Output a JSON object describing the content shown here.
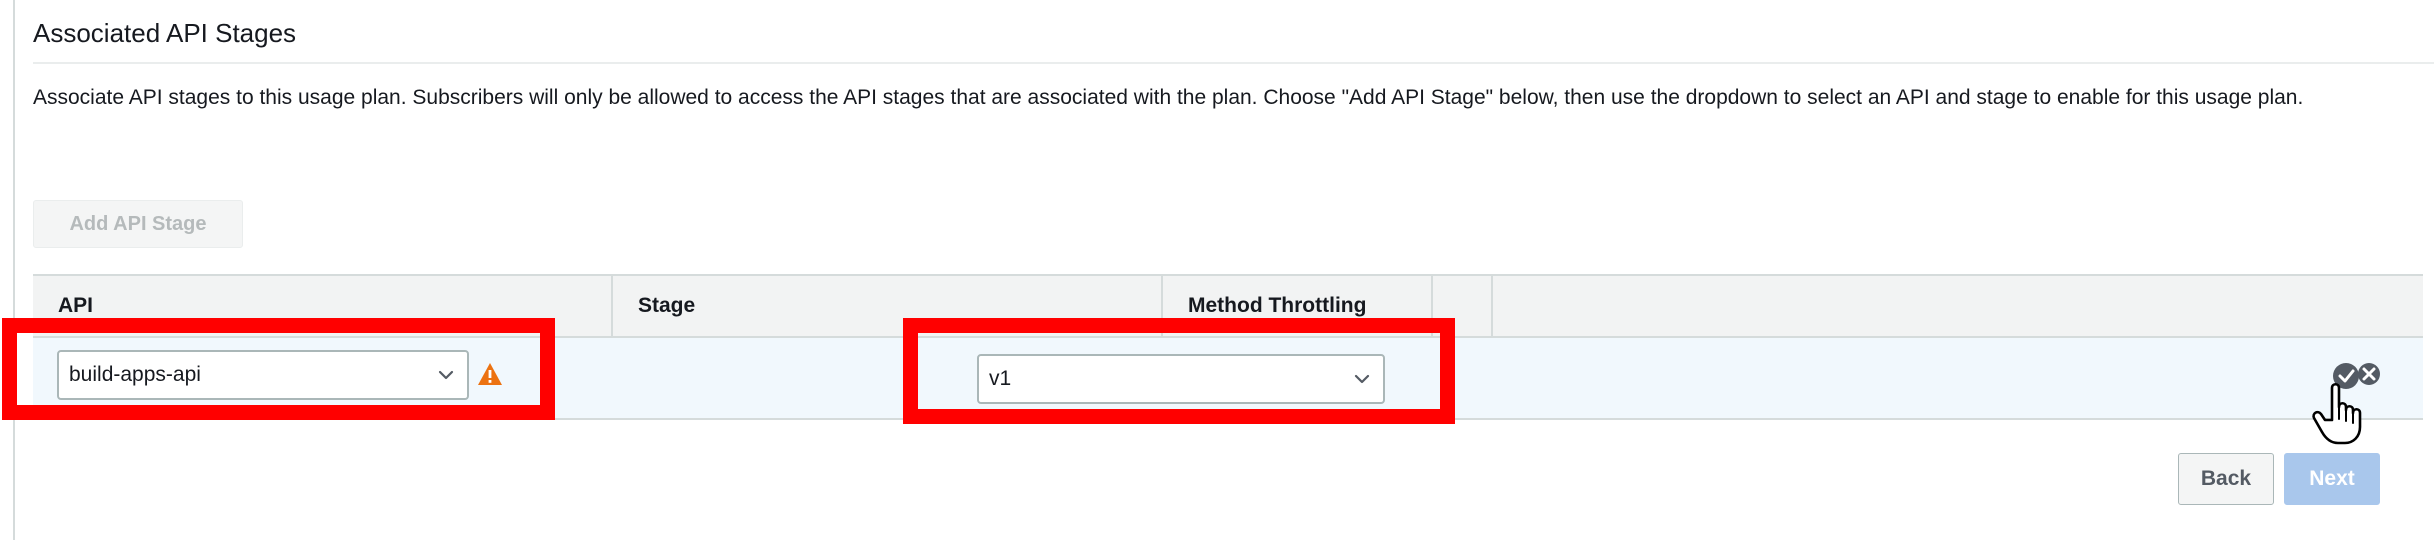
{
  "section": {
    "title": "Associated API Stages",
    "description": "Associate API stages to this usage plan. Subscribers will only be allowed to access the API stages that are associated with the plan. Choose \"Add API Stage\" below, then use the dropdown to select an API and stage to enable for this usage plan."
  },
  "toolbar": {
    "add_label": "Add API Stage"
  },
  "table": {
    "columns": [
      "API",
      "Stage",
      "Method Throttling",
      "",
      ""
    ],
    "rows": [
      {
        "api": "build-apps-api",
        "stage": "v1",
        "api_warning_icon": "warning-icon",
        "action_icons": [
          "checkmark-icon",
          "remove-icon"
        ]
      }
    ]
  },
  "footer": {
    "back_label": "Back",
    "next_label": "Next"
  },
  "colors": {
    "highlight": "#ff0000",
    "row_selected": "#f1f8fd",
    "warning": "#ec7211",
    "next_disabled": "#a9c7ec"
  }
}
